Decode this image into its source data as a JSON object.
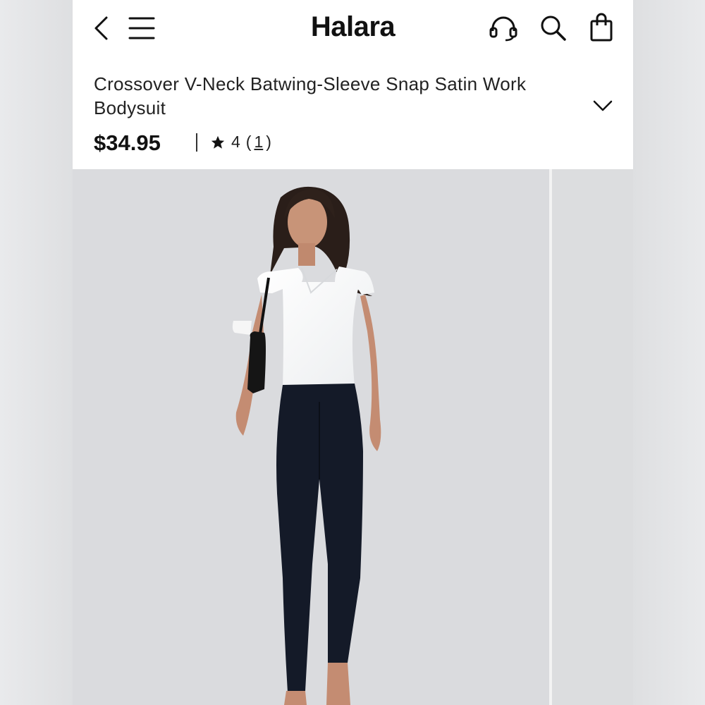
{
  "header": {
    "brand": "Halara",
    "icons": [
      "back-arrow-icon",
      "menu-icon",
      "headset-icon",
      "search-icon",
      "shopping-bag-icon"
    ]
  },
  "product": {
    "title": "Crossover V-Neck Batwing-Sleeve Snap Satin Work Bodysuit",
    "price": "$34.95",
    "rating": "4",
    "rating_open": "(",
    "review_count": "1",
    "rating_close": ")"
  },
  "colors": {
    "background": "#dedfe1",
    "panel": "#ffffff",
    "text": "#111111",
    "image_background": "#dadbde"
  }
}
